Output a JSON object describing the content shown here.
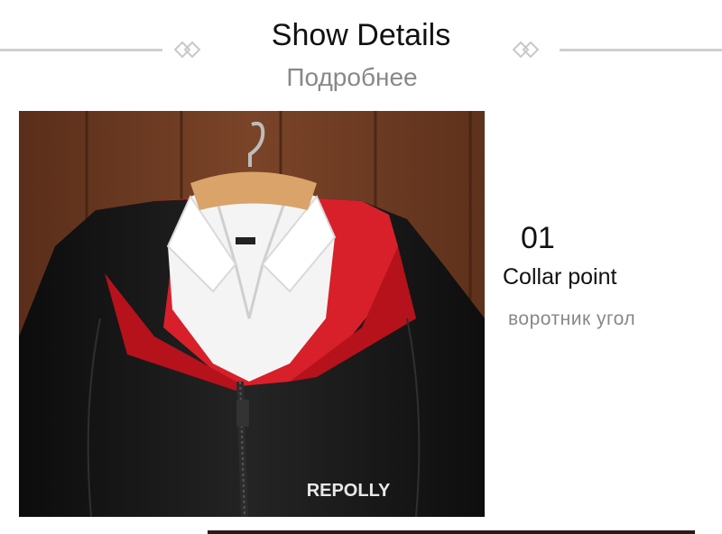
{
  "header": {
    "title": "Show Details",
    "subtitle": "Подробнее"
  },
  "detail": {
    "number": "01",
    "title": "Collar point",
    "subtitle": "воротник  угол"
  },
  "photo": {
    "brand_text": "REPOLLY",
    "colors": {
      "wood": "#6b3a22",
      "jacket": "#141414",
      "hood_lining": "#d8202a",
      "shirt": "#f4f4f4",
      "hanger": "#d9a36a"
    }
  },
  "colors": {
    "rule": "#cfcfcf",
    "title_text": "#111111",
    "sub_text": "#888888"
  }
}
